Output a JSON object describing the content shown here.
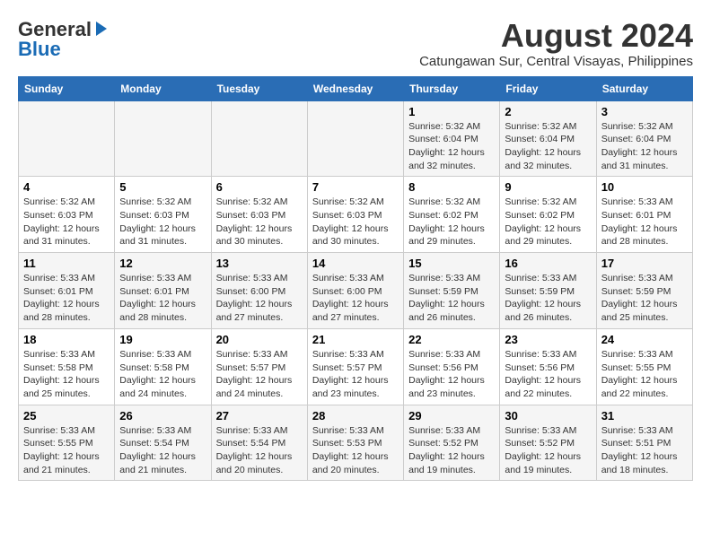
{
  "header": {
    "logo_general": "General",
    "logo_blue": "Blue",
    "month_year": "August 2024",
    "location": "Catungawan Sur, Central Visayas, Philippines"
  },
  "days_of_week": [
    "Sunday",
    "Monday",
    "Tuesday",
    "Wednesday",
    "Thursday",
    "Friday",
    "Saturday"
  ],
  "weeks": [
    [
      {
        "day": "",
        "info": ""
      },
      {
        "day": "",
        "info": ""
      },
      {
        "day": "",
        "info": ""
      },
      {
        "day": "",
        "info": ""
      },
      {
        "day": "1",
        "info": "Sunrise: 5:32 AM\nSunset: 6:04 PM\nDaylight: 12 hours\nand 32 minutes."
      },
      {
        "day": "2",
        "info": "Sunrise: 5:32 AM\nSunset: 6:04 PM\nDaylight: 12 hours\nand 32 minutes."
      },
      {
        "day": "3",
        "info": "Sunrise: 5:32 AM\nSunset: 6:04 PM\nDaylight: 12 hours\nand 31 minutes."
      }
    ],
    [
      {
        "day": "4",
        "info": "Sunrise: 5:32 AM\nSunset: 6:03 PM\nDaylight: 12 hours\nand 31 minutes."
      },
      {
        "day": "5",
        "info": "Sunrise: 5:32 AM\nSunset: 6:03 PM\nDaylight: 12 hours\nand 31 minutes."
      },
      {
        "day": "6",
        "info": "Sunrise: 5:32 AM\nSunset: 6:03 PM\nDaylight: 12 hours\nand 30 minutes."
      },
      {
        "day": "7",
        "info": "Sunrise: 5:32 AM\nSunset: 6:03 PM\nDaylight: 12 hours\nand 30 minutes."
      },
      {
        "day": "8",
        "info": "Sunrise: 5:32 AM\nSunset: 6:02 PM\nDaylight: 12 hours\nand 29 minutes."
      },
      {
        "day": "9",
        "info": "Sunrise: 5:32 AM\nSunset: 6:02 PM\nDaylight: 12 hours\nand 29 minutes."
      },
      {
        "day": "10",
        "info": "Sunrise: 5:33 AM\nSunset: 6:01 PM\nDaylight: 12 hours\nand 28 minutes."
      }
    ],
    [
      {
        "day": "11",
        "info": "Sunrise: 5:33 AM\nSunset: 6:01 PM\nDaylight: 12 hours\nand 28 minutes."
      },
      {
        "day": "12",
        "info": "Sunrise: 5:33 AM\nSunset: 6:01 PM\nDaylight: 12 hours\nand 28 minutes."
      },
      {
        "day": "13",
        "info": "Sunrise: 5:33 AM\nSunset: 6:00 PM\nDaylight: 12 hours\nand 27 minutes."
      },
      {
        "day": "14",
        "info": "Sunrise: 5:33 AM\nSunset: 6:00 PM\nDaylight: 12 hours\nand 27 minutes."
      },
      {
        "day": "15",
        "info": "Sunrise: 5:33 AM\nSunset: 5:59 PM\nDaylight: 12 hours\nand 26 minutes."
      },
      {
        "day": "16",
        "info": "Sunrise: 5:33 AM\nSunset: 5:59 PM\nDaylight: 12 hours\nand 26 minutes."
      },
      {
        "day": "17",
        "info": "Sunrise: 5:33 AM\nSunset: 5:59 PM\nDaylight: 12 hours\nand 25 minutes."
      }
    ],
    [
      {
        "day": "18",
        "info": "Sunrise: 5:33 AM\nSunset: 5:58 PM\nDaylight: 12 hours\nand 25 minutes."
      },
      {
        "day": "19",
        "info": "Sunrise: 5:33 AM\nSunset: 5:58 PM\nDaylight: 12 hours\nand 24 minutes."
      },
      {
        "day": "20",
        "info": "Sunrise: 5:33 AM\nSunset: 5:57 PM\nDaylight: 12 hours\nand 24 minutes."
      },
      {
        "day": "21",
        "info": "Sunrise: 5:33 AM\nSunset: 5:57 PM\nDaylight: 12 hours\nand 23 minutes."
      },
      {
        "day": "22",
        "info": "Sunrise: 5:33 AM\nSunset: 5:56 PM\nDaylight: 12 hours\nand 23 minutes."
      },
      {
        "day": "23",
        "info": "Sunrise: 5:33 AM\nSunset: 5:56 PM\nDaylight: 12 hours\nand 22 minutes."
      },
      {
        "day": "24",
        "info": "Sunrise: 5:33 AM\nSunset: 5:55 PM\nDaylight: 12 hours\nand 22 minutes."
      }
    ],
    [
      {
        "day": "25",
        "info": "Sunrise: 5:33 AM\nSunset: 5:55 PM\nDaylight: 12 hours\nand 21 minutes."
      },
      {
        "day": "26",
        "info": "Sunrise: 5:33 AM\nSunset: 5:54 PM\nDaylight: 12 hours\nand 21 minutes."
      },
      {
        "day": "27",
        "info": "Sunrise: 5:33 AM\nSunset: 5:54 PM\nDaylight: 12 hours\nand 20 minutes."
      },
      {
        "day": "28",
        "info": "Sunrise: 5:33 AM\nSunset: 5:53 PM\nDaylight: 12 hours\nand 20 minutes."
      },
      {
        "day": "29",
        "info": "Sunrise: 5:33 AM\nSunset: 5:52 PM\nDaylight: 12 hours\nand 19 minutes."
      },
      {
        "day": "30",
        "info": "Sunrise: 5:33 AM\nSunset: 5:52 PM\nDaylight: 12 hours\nand 19 minutes."
      },
      {
        "day": "31",
        "info": "Sunrise: 5:33 AM\nSunset: 5:51 PM\nDaylight: 12 hours\nand 18 minutes."
      }
    ]
  ]
}
